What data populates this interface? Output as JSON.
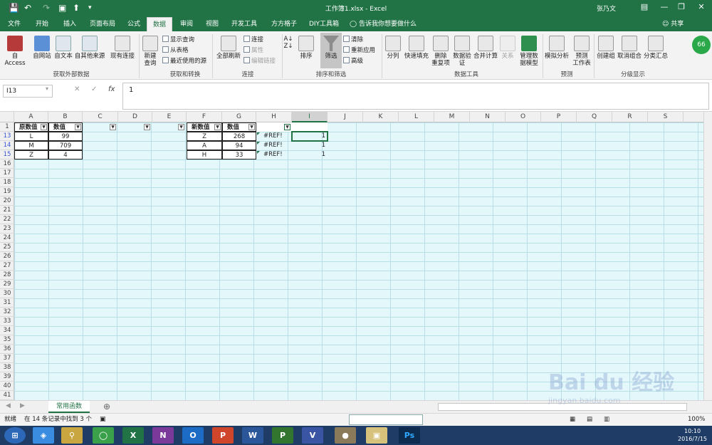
{
  "titlebar": {
    "title": "工作簿1.xlsx - Excel",
    "user": "张乃文"
  },
  "tabs": [
    "文件",
    "开始",
    "插入",
    "页面布局",
    "公式",
    "数据",
    "审阅",
    "视图",
    "开发工具",
    "方方格子",
    "DIY工具箱"
  ],
  "tell_me": "告诉我你想要做什么",
  "share": "共享",
  "ribbon": {
    "get_external": {
      "label": "获取外部数据",
      "access": "自 Access",
      "web": "自网站",
      "text": "自文本",
      "other": "自其他来源",
      "existing": "现有连接"
    },
    "transform": {
      "label": "获取和转换",
      "new_query": "新建\n查询",
      "show_query": "显示查询",
      "from_table": "从表格",
      "recent": "最近使用的源"
    },
    "connections": {
      "label": "连接",
      "refresh": "全部刷新",
      "conn": "连接",
      "props": "属性",
      "edit_links": "编辑链接"
    },
    "sort_filter": {
      "label": "排序和筛选",
      "sort": "排序",
      "filter": "筛选",
      "clear": "清除",
      "reapply": "重新应用",
      "advanced": "高级"
    },
    "data_tools": {
      "label": "数据工具",
      "split": "分列",
      "flash": "快速填充",
      "remove_dup": "删除\n重复项",
      "validation": "数据验\n证",
      "consolidate": "合并计算",
      "relations": "关系",
      "model": "管理数\n据模型"
    },
    "forecast": {
      "label": "预测",
      "whatif": "模拟分析",
      "sheet": "预测\n工作表"
    },
    "outline": {
      "label": "分级显示",
      "group": "创建组",
      "ungroup": "取消组合",
      "subtotal": "分类汇总"
    },
    "avatar": "66"
  },
  "formula_bar": {
    "name_box": "I13",
    "formula": "1"
  },
  "columns": [
    "A",
    "B",
    "C",
    "D",
    "E",
    "F",
    "G",
    "H",
    "I",
    "J",
    "K",
    "L",
    "M",
    "N",
    "O",
    "P",
    "Q",
    "R",
    "S"
  ],
  "rows": [
    "1",
    "13",
    "14",
    "15",
    "16",
    "17",
    "18",
    "19",
    "20",
    "21",
    "22",
    "23",
    "24",
    "25",
    "26",
    "27",
    "28",
    "29",
    "30",
    "31",
    "32",
    "33",
    "34",
    "35",
    "36",
    "37",
    "38",
    "39",
    "40",
    "41"
  ],
  "table1": {
    "h1": "原数值",
    "h2": "数值",
    "rows": [
      [
        "L",
        "99"
      ],
      [
        "M",
        "709"
      ],
      [
        "Z",
        "4"
      ]
    ]
  },
  "table2": {
    "h1": "新数值",
    "h2": "数值",
    "rows": [
      [
        "Z",
        "268",
        "#REF!",
        "1"
      ],
      [
        "A",
        "94",
        "#REF!",
        "1"
      ],
      [
        "H",
        "33",
        "#REF!",
        "1"
      ]
    ]
  },
  "sheet_tab": "常用函数",
  "status": {
    "ready": "就绪",
    "found": "在 14 条记录中找到 3 个",
    "zoom": "100%"
  },
  "taskbar": {
    "time": "10:10",
    "date": "2016/7/15"
  },
  "watermark": "Bai du 经验",
  "watermark_url": "jingyan.baidu.com"
}
